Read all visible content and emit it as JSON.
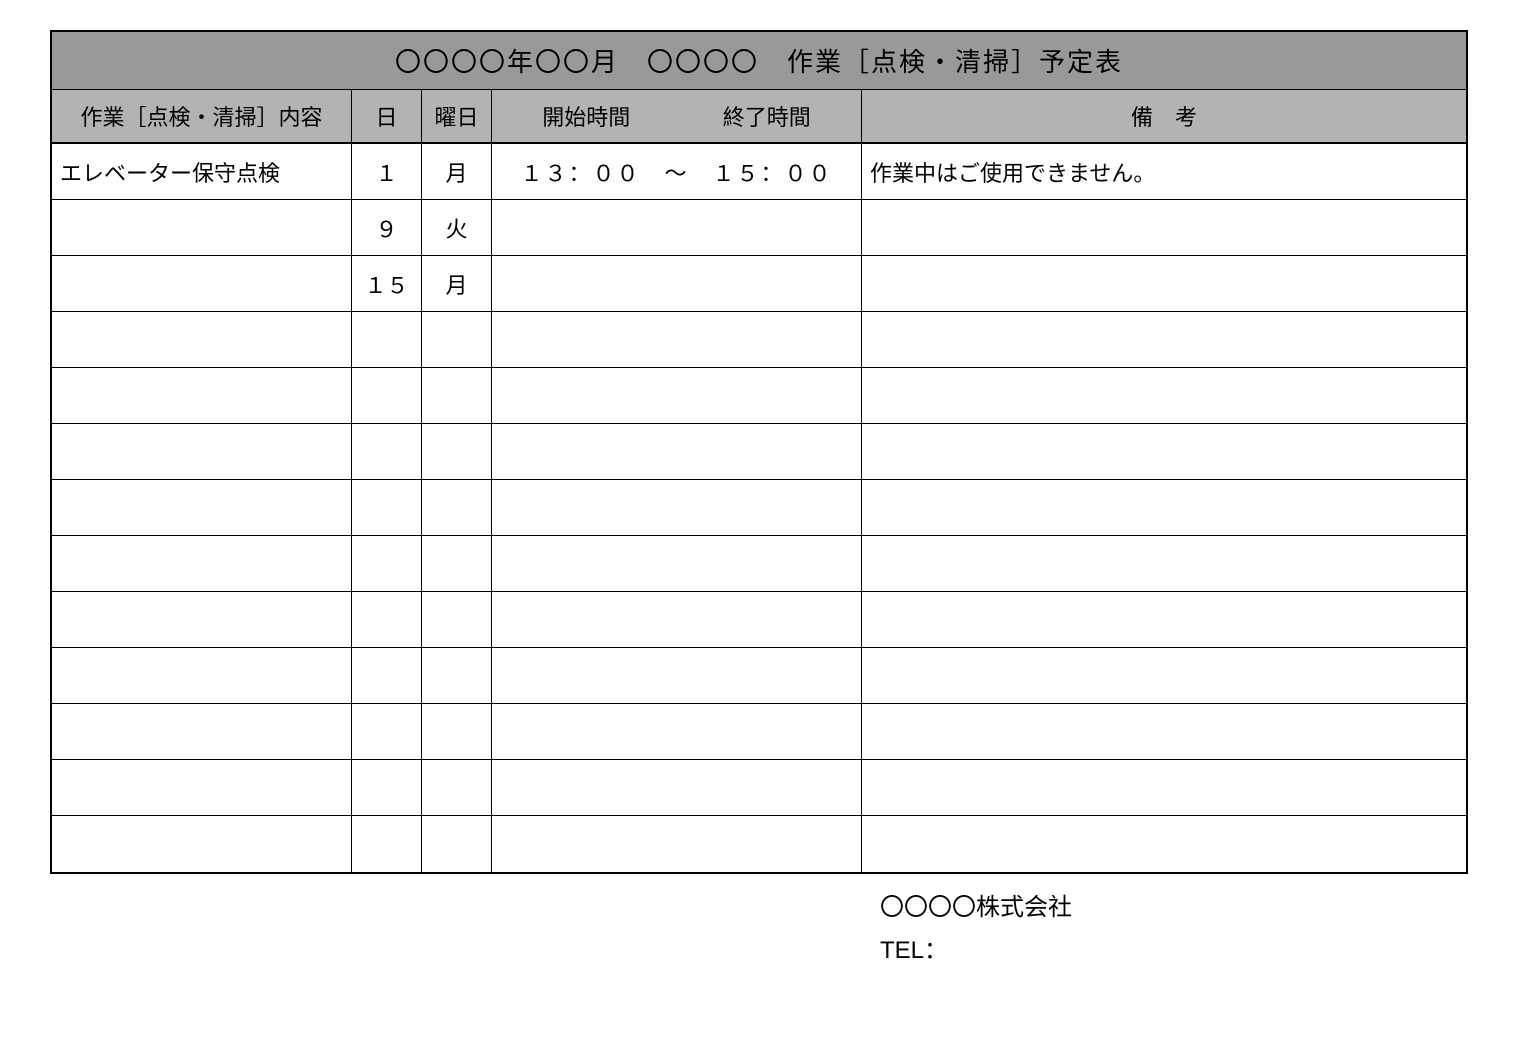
{
  "title": "〇〇〇〇年〇〇月　〇〇〇〇　作業［点検・清掃］予定表",
  "headers": {
    "content": "作業［点検・清掃］内容",
    "day": "日",
    "weekday": "曜日",
    "start": "開始時間",
    "end": "終了時間",
    "note": "備　考"
  },
  "rows": [
    {
      "content": "エレベーター保守点検",
      "day": "１",
      "weekday": "月",
      "time": "１３：００　～　１５：００",
      "note": "作業中はご使用できません。"
    },
    {
      "content": "",
      "day": "９",
      "weekday": "火",
      "time": "",
      "note": ""
    },
    {
      "content": "",
      "day": "１５",
      "weekday": "月",
      "time": "",
      "note": ""
    },
    {
      "content": "",
      "day": "",
      "weekday": "",
      "time": "",
      "note": ""
    },
    {
      "content": "",
      "day": "",
      "weekday": "",
      "time": "",
      "note": ""
    },
    {
      "content": "",
      "day": "",
      "weekday": "",
      "time": "",
      "note": ""
    },
    {
      "content": "",
      "day": "",
      "weekday": "",
      "time": "",
      "note": ""
    },
    {
      "content": "",
      "day": "",
      "weekday": "",
      "time": "",
      "note": ""
    },
    {
      "content": "",
      "day": "",
      "weekday": "",
      "time": "",
      "note": ""
    },
    {
      "content": "",
      "day": "",
      "weekday": "",
      "time": "",
      "note": ""
    },
    {
      "content": "",
      "day": "",
      "weekday": "",
      "time": "",
      "note": ""
    },
    {
      "content": "",
      "day": "",
      "weekday": "",
      "time": "",
      "note": ""
    },
    {
      "content": "",
      "day": "",
      "weekday": "",
      "time": "",
      "note": ""
    }
  ],
  "footer": {
    "company": "〇〇〇〇株式会社",
    "tel_label": "TEL："
  }
}
